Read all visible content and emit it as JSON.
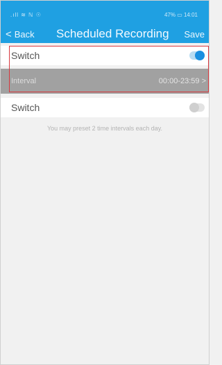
{
  "status_bar": {
    "left_icons": ".ıll ≋ ℕ ☉",
    "right_text": "47% ▭ 14:01"
  },
  "nav": {
    "back_label": "Back",
    "title": "Scheduled Recording",
    "save_label": "Save"
  },
  "rows": {
    "switch1": {
      "label": "Switch",
      "state": "on"
    },
    "interval": {
      "label": "Interval",
      "value": "00:00-23:59 >"
    },
    "switch2": {
      "label": "Switch",
      "state": "off"
    }
  },
  "hint": "You may preset 2 time intervals each day.",
  "colors": {
    "accent": "#1fa0e2",
    "toggle_on": "#1b8fe0",
    "highlight_border": "#d8393f"
  }
}
